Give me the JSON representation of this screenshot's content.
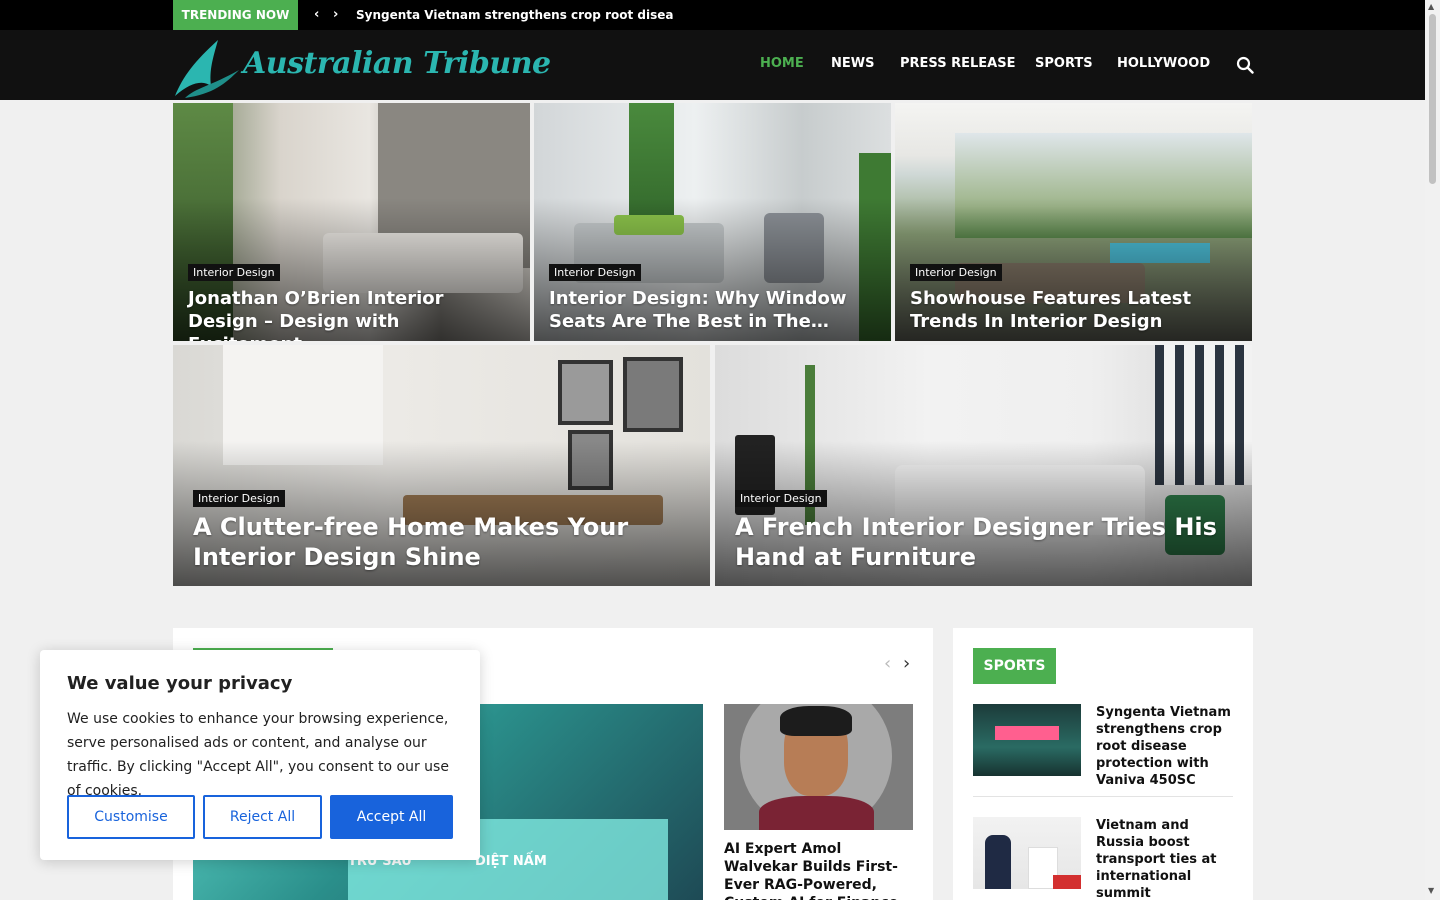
{
  "trending": {
    "label": "TRENDING NOW",
    "prev": "‹",
    "next": "›",
    "headline": "Syngenta Vietnam strengthens crop root disease protec"
  },
  "header": {
    "logo_text": "Australian Tribune",
    "nav": [
      "HOME",
      "NEWS",
      "PRESS RELEASE",
      "SPORTS",
      "HOLLYWOOD"
    ],
    "active_nav": "HOME",
    "search_icon": "search-icon"
  },
  "hero": [
    {
      "category": "Interior Design",
      "title": "Jonathan O’Brien Interior Design – Design with Excitement"
    },
    {
      "category": "Interior Design",
      "title": "Interior Design: Why Window Seats Are The Best in The…"
    },
    {
      "category": "Interior Design",
      "title": "Showhouse Features Latest Trends In Interior Design"
    },
    {
      "category": "Interior Design",
      "title": "A Clutter-free Home Makes Your Interior Design Shine"
    },
    {
      "category": "Interior Design",
      "title": "A French Interior Designer Tries His Hand at Furniture"
    }
  ],
  "main": {
    "feature_words": [
      "TRỪ SÂU",
      "DIỆT NẤM"
    ],
    "side_title": "AI Expert Amol Walvekar Builds First-Ever RAG-Powered, Custom AI for Finance Pr…",
    "arrow_prev": "‹",
    "arrow_next": "›"
  },
  "sports": {
    "label": "SPORTS",
    "items": [
      {
        "title": "Syngenta Vietnam strengthens crop root disease protection with Vaniva 450SC"
      },
      {
        "title": "Vietnam and Russia boost transport ties at international summit"
      }
    ]
  },
  "cookie": {
    "title": "We value your privacy",
    "body": "We use cookies to enhance your browsing experience, serve personalised ads or content, and analyse our traffic. By clicking \"Accept All\", you consent to our use of cookies.",
    "customise": "Customise",
    "reject": "Reject All",
    "accept": "Accept All"
  },
  "colors": {
    "accent": "#4caf50",
    "logo": "#2bb6b0",
    "cookie_button": "#1863dc"
  }
}
